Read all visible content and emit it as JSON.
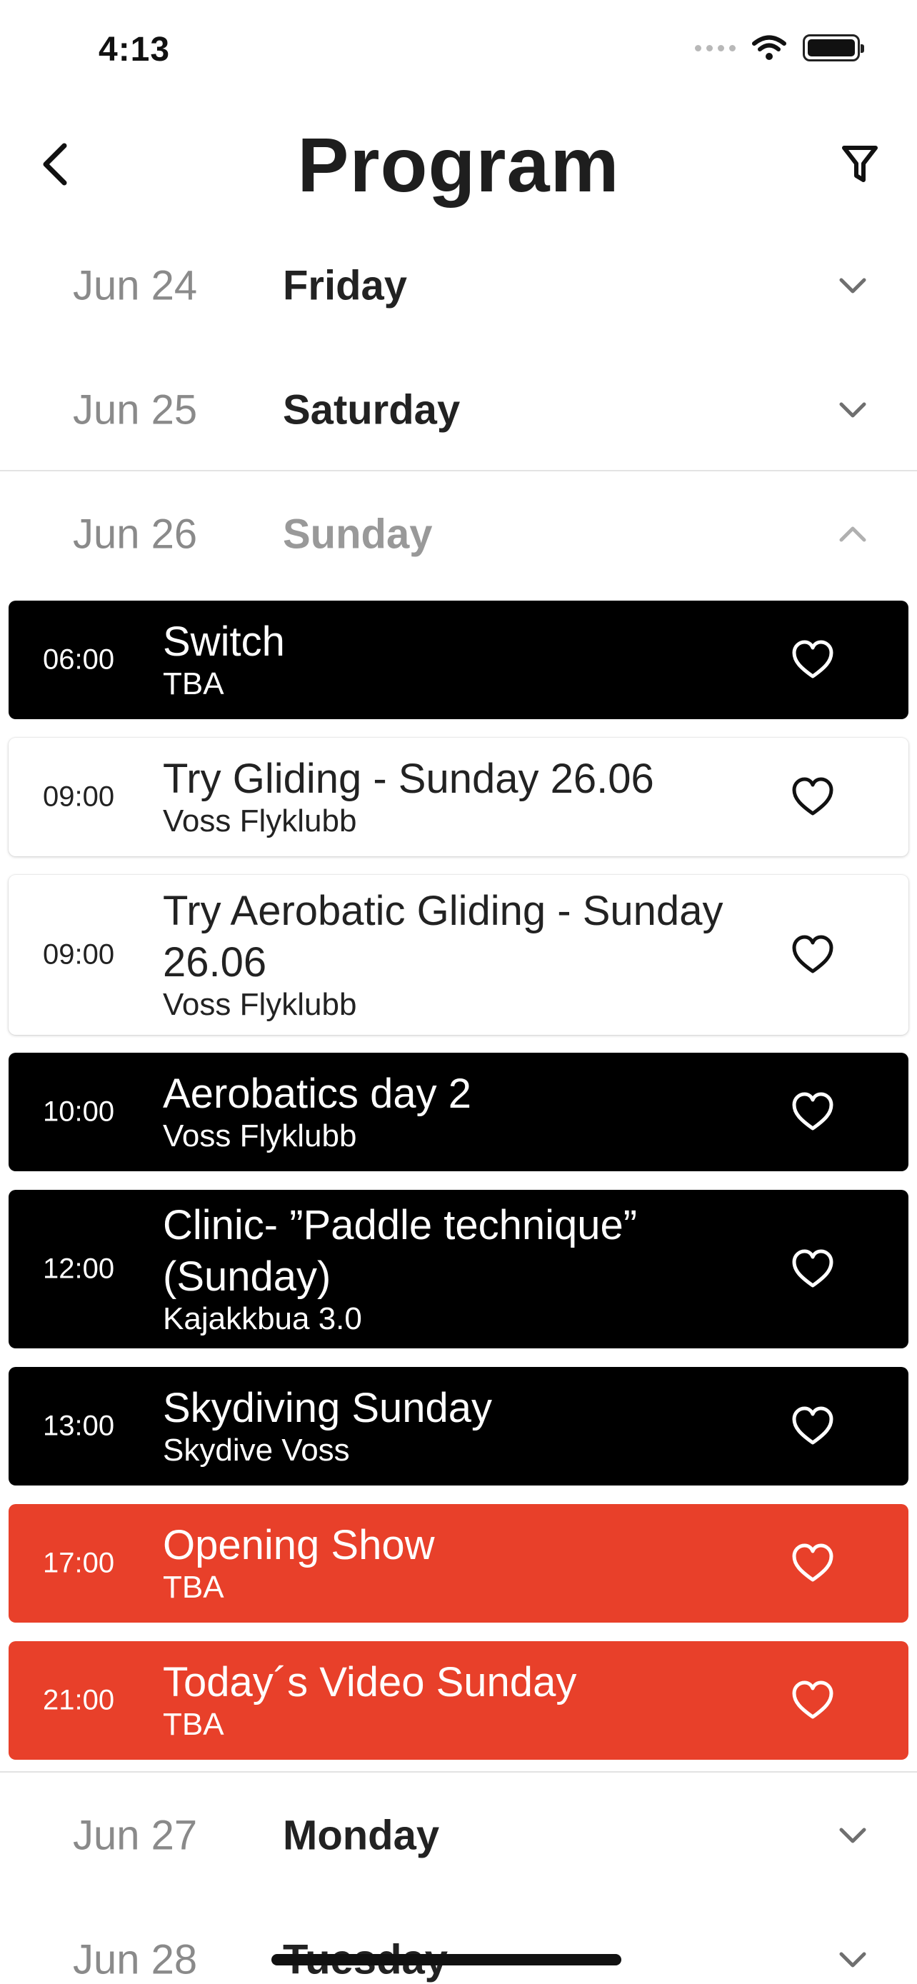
{
  "status_bar": {
    "time": "4:13"
  },
  "header": {
    "title": "Program",
    "back_icon": "chevron-left-icon",
    "filter_icon": "filter-icon"
  },
  "colors": {
    "dark": "#000000",
    "accent": "#e8402a",
    "muted": "#8a8a8a"
  },
  "days": [
    {
      "date": "Jun 24",
      "name": "Friday",
      "expanded": false
    },
    {
      "date": "Jun 25",
      "name": "Saturday",
      "expanded": false
    },
    {
      "date": "Jun 26",
      "name": "Sunday",
      "expanded": true
    },
    {
      "date": "Jun 27",
      "name": "Monday",
      "expanded": false
    },
    {
      "date": "Jun 28",
      "name": "Tuesday",
      "expanded": false
    }
  ],
  "events": [
    {
      "time": "06:00",
      "title": "Switch",
      "venue": "TBA",
      "style": "dark"
    },
    {
      "time": "09:00",
      "title": "Try Gliding - Sunday 26.06",
      "venue": "Voss Flyklubb",
      "style": "light"
    },
    {
      "time": "09:00",
      "title": "Try Aerobatic Gliding - Sunday 26.06",
      "venue": "Voss Flyklubb",
      "style": "light"
    },
    {
      "time": "10:00",
      "title": "Aerobatics day 2",
      "venue": "Voss Flyklubb",
      "style": "dark"
    },
    {
      "time": "12:00",
      "title": "Clinic- ”Paddle technique” (Sunday)",
      "venue": "Kajakkbua 3.0",
      "style": "dark"
    },
    {
      "time": "13:00",
      "title": "Skydiving Sunday",
      "venue": "Skydive Voss",
      "style": "dark"
    },
    {
      "time": "17:00",
      "title": "Opening Show",
      "venue": "TBA",
      "style": "red"
    },
    {
      "time": "21:00",
      "title": "Today´s Video Sunday",
      "venue": "TBA",
      "style": "red"
    }
  ]
}
